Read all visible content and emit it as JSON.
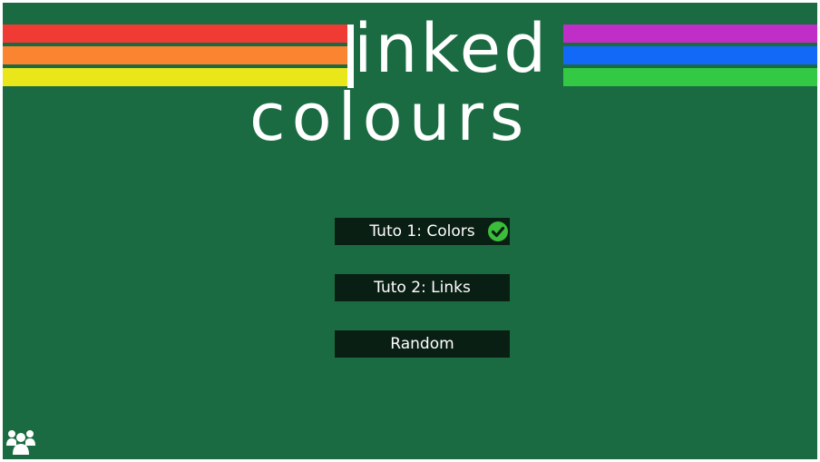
{
  "logo": {
    "line1": "linked",
    "line2": "colours"
  },
  "colors": {
    "background": "#1b6b42",
    "stripes_left": [
      "#f03b35",
      "#fb8430",
      "#e9e61a"
    ],
    "stripes_right": [
      "#c12ec7",
      "#1269f8",
      "#34c944"
    ],
    "button_bg": "#0a1f14",
    "check": "#3bbd3b"
  },
  "menu": {
    "buttons": [
      {
        "label": "Tuto 1: Colors",
        "completed": true
      },
      {
        "label": "Tuto 2: Links",
        "completed": false
      },
      {
        "label": "Random",
        "completed": false
      }
    ]
  },
  "icons": {
    "completed": "check-circle-icon",
    "community": "users-icon"
  }
}
